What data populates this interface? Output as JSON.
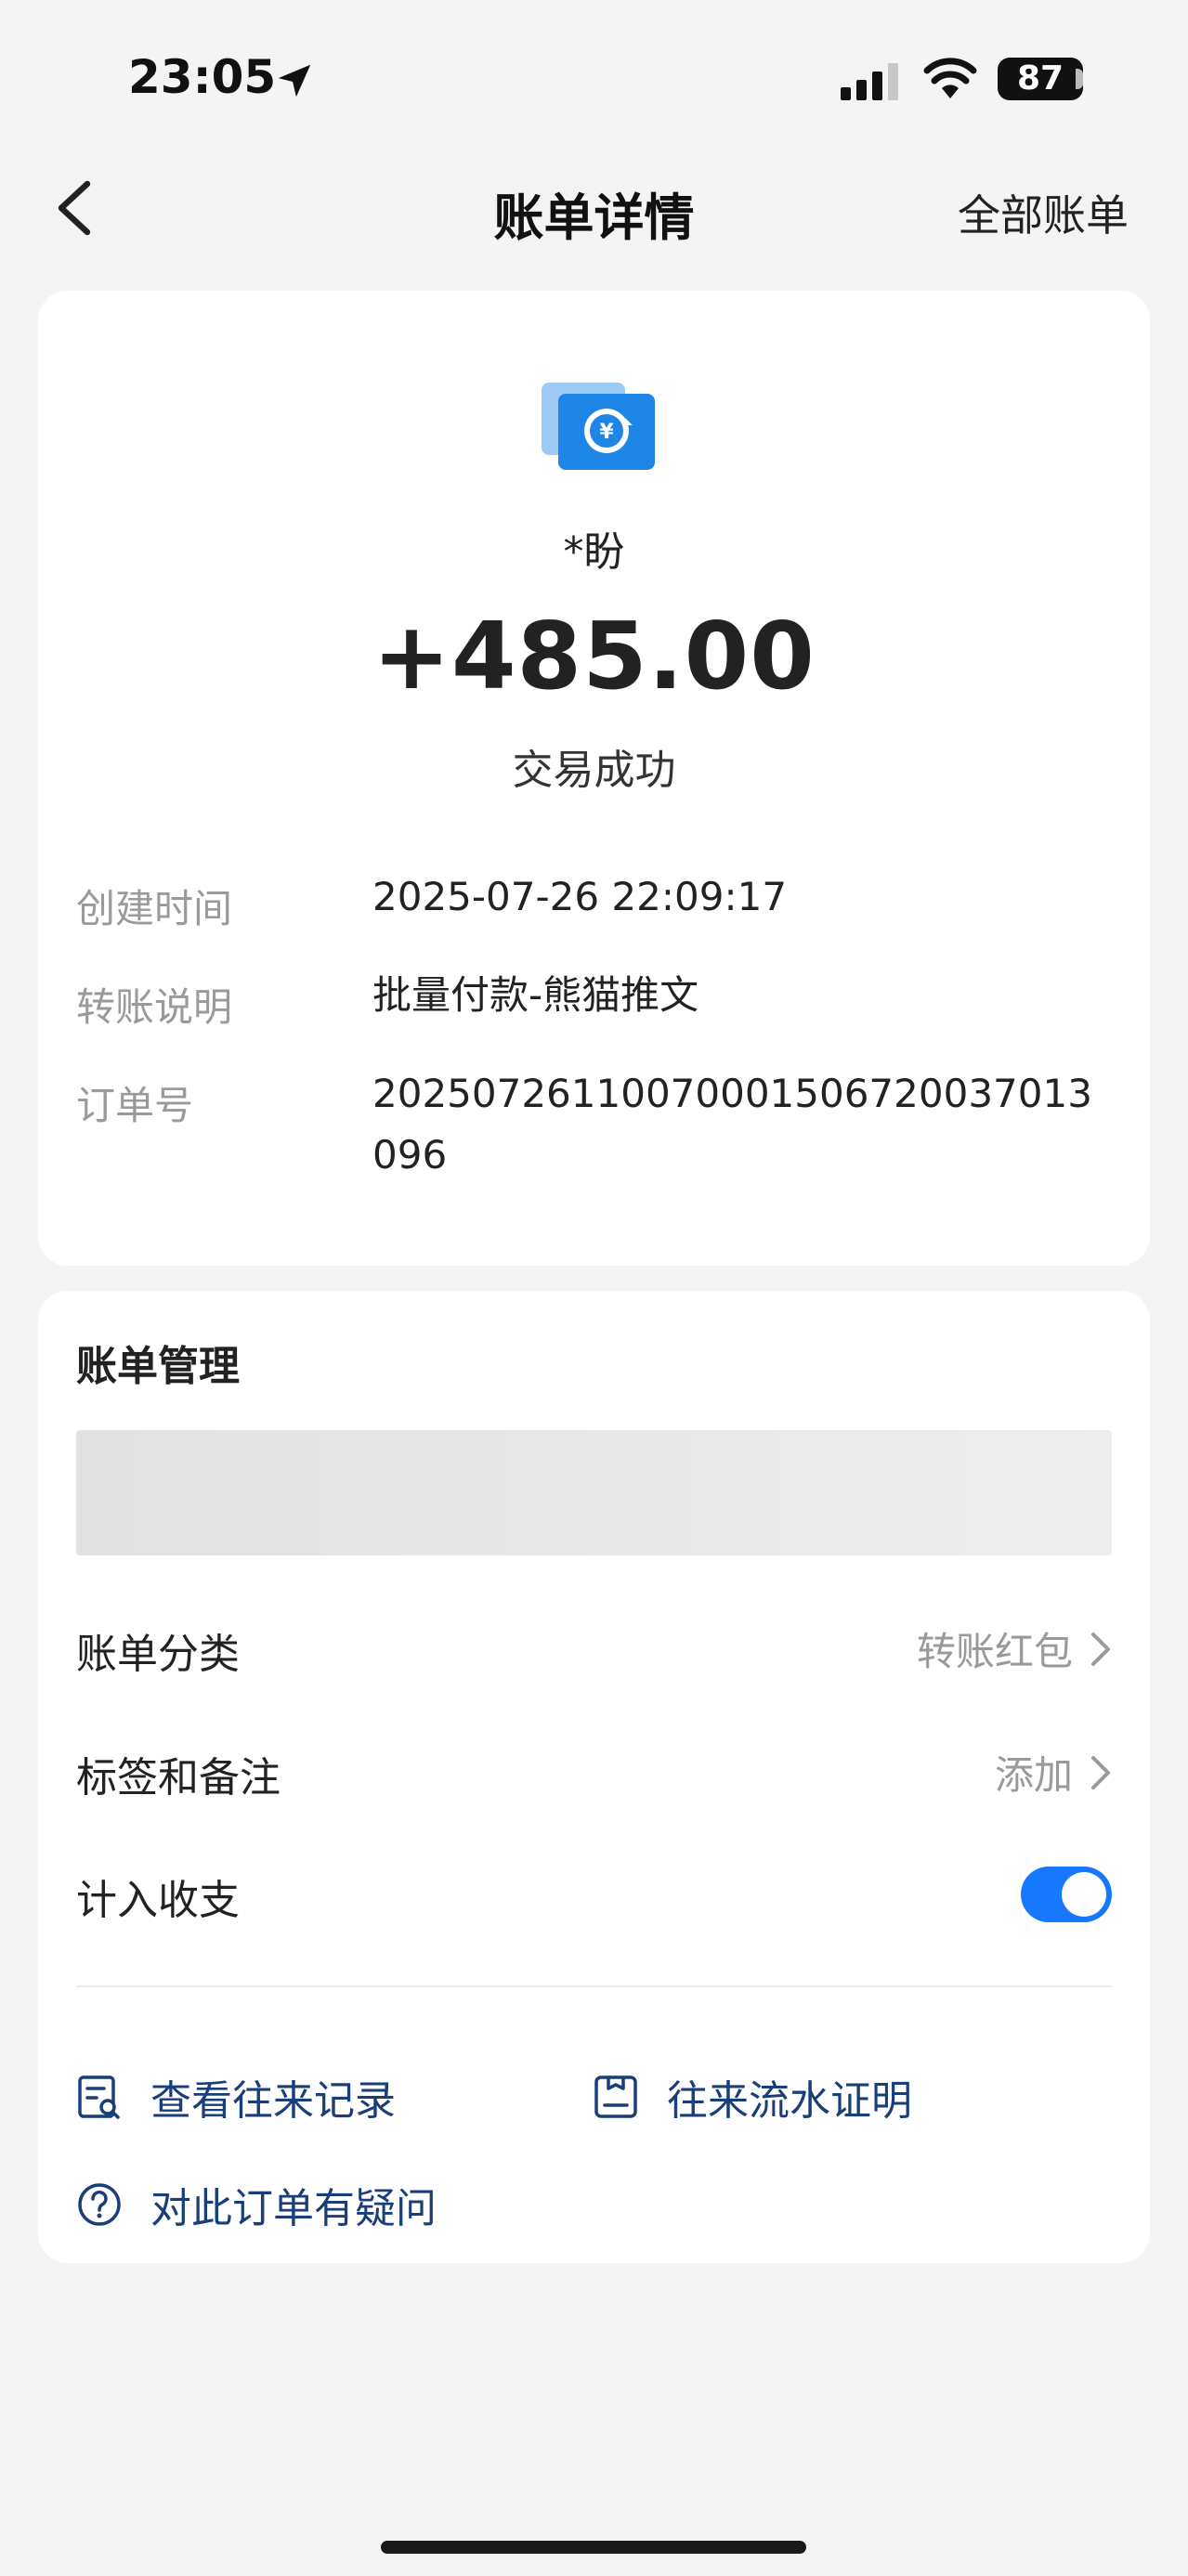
{
  "status_bar": {
    "time": "23:05",
    "battery": "87"
  },
  "nav": {
    "title": "账单详情",
    "right_link": "全部账单"
  },
  "summary": {
    "payer": "*盼",
    "amount": "+485.00",
    "status": "交易成功"
  },
  "details": [
    {
      "label": "创建时间",
      "value": "2025-07-26 22:09:17"
    },
    {
      "label": "转账说明",
      "value": "批量付款-熊猫推文"
    },
    {
      "label": "订单号",
      "value": "20250726110070001506720037013096"
    }
  ],
  "management": {
    "title": "账单管理",
    "category": {
      "label": "账单分类",
      "value": "转账红包"
    },
    "tags": {
      "label": "标签和备注",
      "value": "添加"
    },
    "include": {
      "label": "计入收支",
      "enabled": true
    }
  },
  "links": {
    "records": "查看往来记录",
    "statement": "往来流水证明",
    "question": "对此订单有疑问"
  },
  "colors": {
    "accent": "#1677ff",
    "link": "#1a3e7a",
    "background": "#f4f4f4"
  }
}
